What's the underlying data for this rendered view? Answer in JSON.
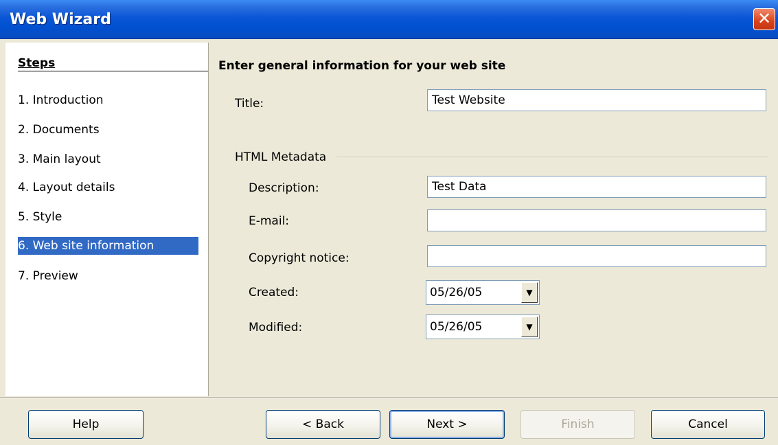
{
  "window": {
    "title": "Web Wizard",
    "close_glyph": "✕"
  },
  "steps": {
    "heading": "Steps",
    "items": [
      {
        "label": "1. Introduction"
      },
      {
        "label": "2. Documents"
      },
      {
        "label": "3. Main layout"
      },
      {
        "label": "4. Layout details"
      },
      {
        "label": "5. Style"
      },
      {
        "label": "6. Web site information",
        "selected": true
      },
      {
        "label": "7. Preview"
      }
    ]
  },
  "content": {
    "heading": "Enter general information for your web site",
    "title_label": "Title:",
    "title_value": "Test Website",
    "group_label": "HTML Metadata",
    "description_label": "Description:",
    "description_value": "Test Data",
    "email_label": "E-mail:",
    "email_value": "",
    "copyright_label": "Copyright notice:",
    "copyright_value": "",
    "created_label": "Created:",
    "created_value": "05/26/05",
    "modified_label": "Modified:",
    "modified_value": "05/26/05",
    "dropdown_glyph": "▼"
  },
  "buttons": {
    "help": "Help",
    "back": "< Back",
    "next": "Next >",
    "finish": "Finish",
    "cancel": "Cancel"
  },
  "colors": {
    "titlebar": "#0a56d6",
    "selection": "#316ac5",
    "dialog_bg": "#ece9d8",
    "close_button": "#d8431d"
  }
}
